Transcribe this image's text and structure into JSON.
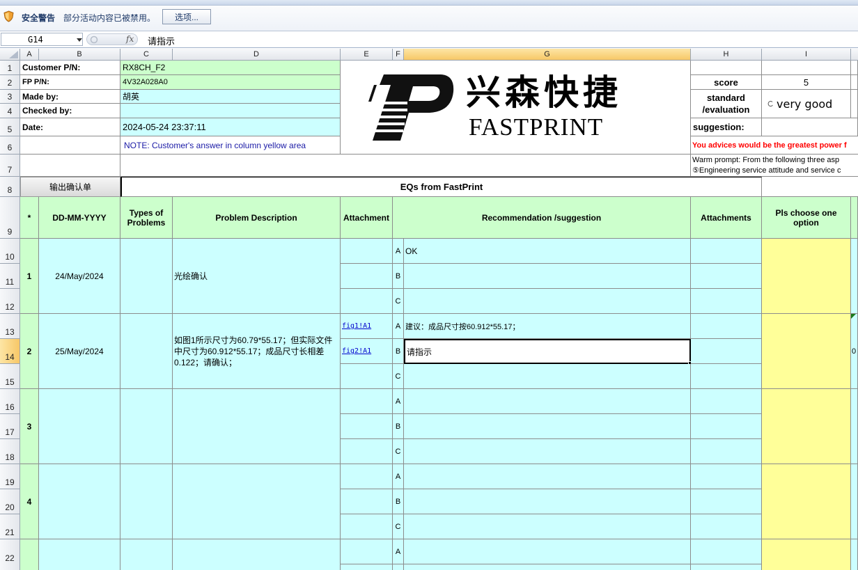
{
  "security_bar": {
    "title": "安全警告",
    "message": "部分活动内容已被禁用。",
    "options_button": "选项..."
  },
  "formula_bar": {
    "name_box": "G14",
    "fx_label": "fx",
    "formula": "请指示"
  },
  "columns": [
    "A",
    "B",
    "C",
    "D",
    "E",
    "F",
    "G",
    "H",
    "I"
  ],
  "rows": [
    "1",
    "2",
    "3",
    "4",
    "5",
    "6",
    "7",
    "8",
    "9",
    "10",
    "11",
    "12",
    "13",
    "14",
    "15",
    "16",
    "17",
    "18",
    "19",
    "20",
    "21",
    "22"
  ],
  "header_info": {
    "customer_pn_label": "Customer P/N:",
    "customer_pn": "RX8CH_F2",
    "fp_pn_label": "FP P/N:",
    "fp_pn": "4V32A028A0",
    "made_by_label": "Made by:",
    "made_by": "胡英",
    "checked_by_label": "Checked by:",
    "checked_by": "",
    "date_label": "Date:",
    "date": "2024-05-24 23:37:11",
    "note": "NOTE: Customer's  answer in column yellow area"
  },
  "logo": {
    "chinese": "兴森快捷",
    "english": "FASTPRINT"
  },
  "score_panel": {
    "score_label": "score",
    "score_value": "5",
    "standard_label_1": "standard",
    "standard_label_2": "/evaluation",
    "standard_value": "very good",
    "suggestion_label": "suggestion:",
    "advice": "You advices would be the greatest power f",
    "warm_prompt": "Warm prompt:  From the following three asp",
    "engineering_line": "⑤Engineering service attitude and service c"
  },
  "export_button": "输出确认单",
  "eqs_title": "EQs from FastPrint",
  "table_header": {
    "star": "*",
    "date": "DD-MM-YYYY",
    "types": "Types of Problems",
    "problem": "Problem Description",
    "attachment": "Attachment",
    "recommendation": "Recommendation /suggestion",
    "attachments": "Attachments",
    "choose": "Pls choose one option"
  },
  "eqs": [
    {
      "no": "1",
      "date": "24/May/2024",
      "problem": "光绘确认",
      "links": [
        "",
        "",
        ""
      ],
      "options": [
        {
          "letter": "A",
          "text": "OK"
        },
        {
          "letter": "B",
          "text": ""
        },
        {
          "letter": "C",
          "text": ""
        }
      ]
    },
    {
      "no": "2",
      "date": "25/May/2024",
      "problem": "如图1所示尺寸为60.79*55.17；但实际文件中尺寸为60.912*55.17；成品尺寸长相差0.122；请确认；",
      "links": [
        "fig1!A1",
        "fig2!A1",
        ""
      ],
      "options": [
        {
          "letter": "A",
          "text": "建议：成品尺寸按60.912*55.17；"
        },
        {
          "letter": "B",
          "text": "请指示"
        },
        {
          "letter": "C",
          "text": ""
        }
      ]
    },
    {
      "no": "3",
      "date": "",
      "problem": "",
      "links": [
        "",
        "",
        ""
      ],
      "options": [
        {
          "letter": "A",
          "text": ""
        },
        {
          "letter": "B",
          "text": ""
        },
        {
          "letter": "C",
          "text": ""
        }
      ]
    },
    {
      "no": "4",
      "date": "",
      "problem": "",
      "links": [
        "",
        "",
        ""
      ],
      "options": [
        {
          "letter": "A",
          "text": ""
        },
        {
          "letter": "B",
          "text": ""
        },
        {
          "letter": "C",
          "text": ""
        }
      ]
    }
  ],
  "partial_row_22": {
    "letter": "A"
  },
  "cut_off_right_value": "0",
  "colors": {
    "green": "#ccffcc",
    "cyan": "#ccffff",
    "yellow": "#ffff99",
    "red_text": "#ff0000",
    "blue_text": "#0000cc"
  }
}
